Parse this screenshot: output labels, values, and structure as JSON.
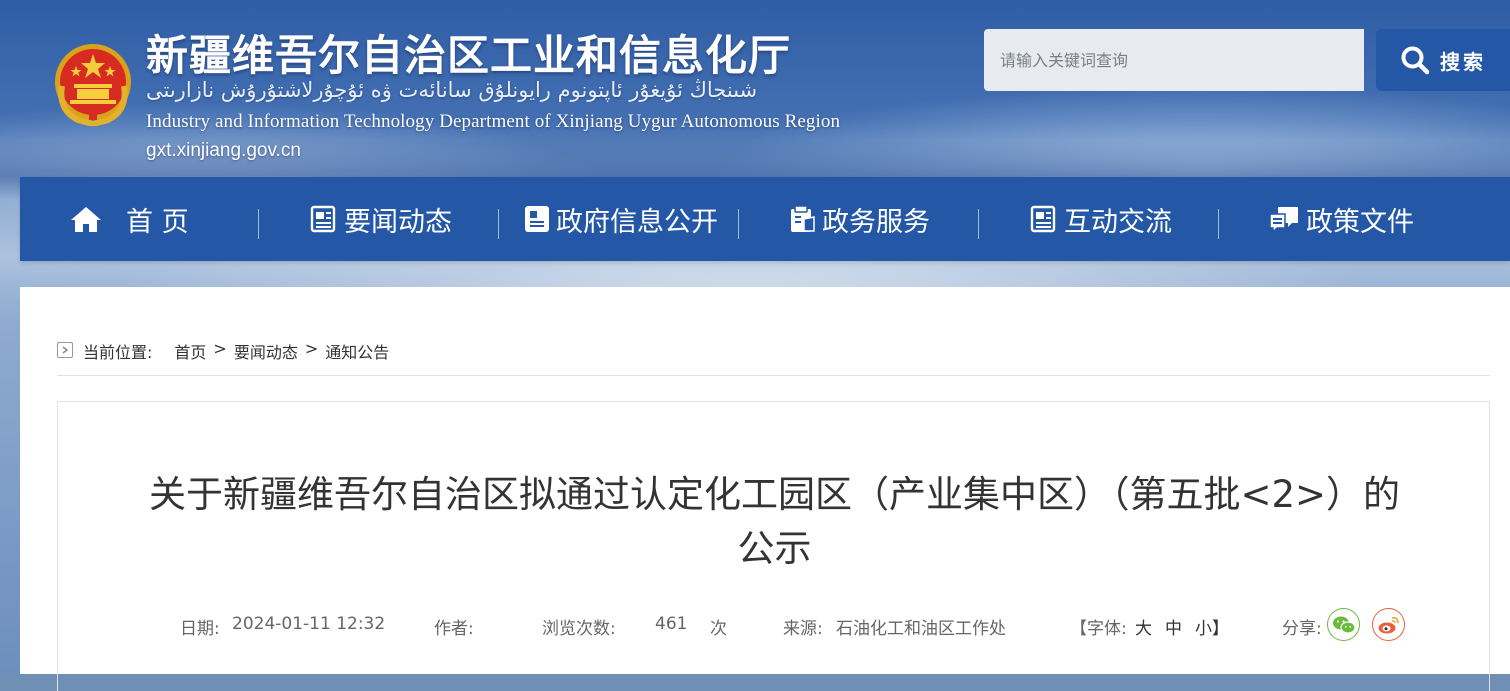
{
  "header": {
    "title_cn": "新疆维吾尔自治区工业和信息化厅",
    "title_ug": "شىنجاڭ ئۇيغۇر ئاپتونوم رايونلۇق سانائەت ۋە ئۇچۇرلاشتۇرۇش نازارىتى",
    "title_en": "Industry and Information Technology Department of Xinjiang Uygur Autonomous Region",
    "url": "gxt.xinjiang.gov.cn"
  },
  "search": {
    "placeholder": "请输入关键词查询",
    "button_label": "搜索"
  },
  "nav": {
    "items": [
      {
        "label": "首 页",
        "icon": "home-icon"
      },
      {
        "label": "要闻动态",
        "icon": "news-icon"
      },
      {
        "label": "政府信息公开",
        "icon": "info-icon"
      },
      {
        "label": "政务服务",
        "icon": "service-icon"
      },
      {
        "label": "互动交流",
        "icon": "interaction-icon"
      },
      {
        "label": "政策文件",
        "icon": "policy-icon"
      }
    ]
  },
  "breadcrumb": {
    "label": "当前位置:",
    "items": [
      "首页",
      "要闻动态",
      "通知公告"
    ],
    "separator": ">"
  },
  "article": {
    "title_line1": "关于新疆维吾尔自治区拟通过认定化工园区（产业集中区）（第五批<2>）的",
    "title_line2": "公示",
    "date_label": "日期:",
    "date": "2024-01-11 12:32",
    "author_label": "作者:",
    "author": "",
    "views_label": "浏览次数:",
    "views": "461",
    "views_unit": "次",
    "source_label": "来源:",
    "source": "石油化工和油区工作处",
    "font_label": "【字体:",
    "font_large": "大",
    "font_medium": "中",
    "font_small": "小】",
    "share_label": "分享:"
  },
  "colors": {
    "nav_bg": "#2457a6",
    "wechat": "#6dbb3b",
    "weibo": "#e8613a"
  }
}
